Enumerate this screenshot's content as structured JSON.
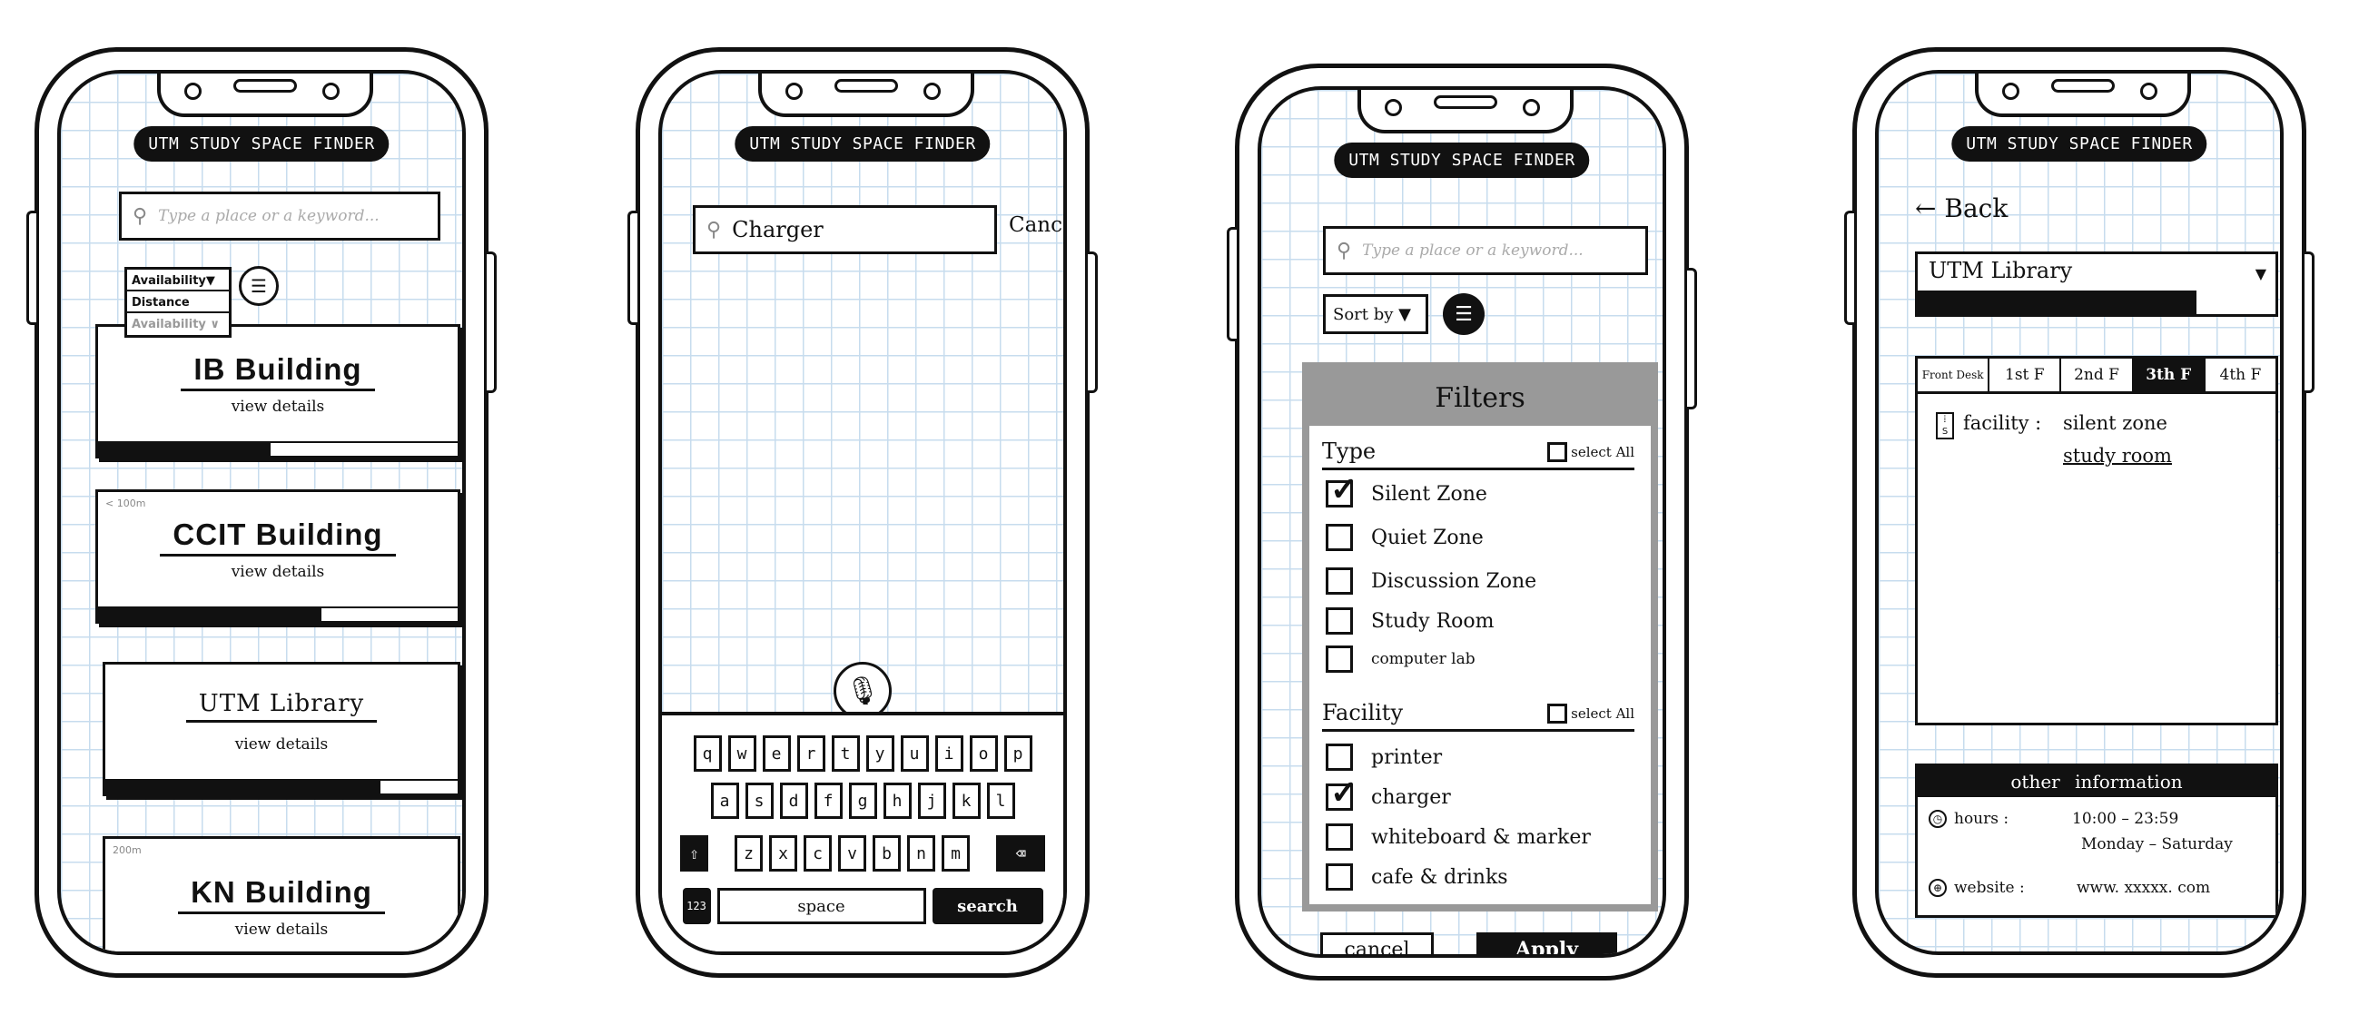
{
  "app_title": "UTM STUDY SPACE FINDER",
  "search": {
    "placeholder": "Type a place or a keyword..."
  },
  "home": {
    "sort_options": [
      "Availability▼",
      "Distance",
      "Availability ∨"
    ],
    "filter_icon": "sliders-icon",
    "buildings": [
      {
        "name": "IB Building",
        "details": "view details",
        "distance": "",
        "availability": 0.48
      },
      {
        "name": "CCIT Building",
        "details": "view details",
        "distance": "< 100m",
        "availability": 0.62
      },
      {
        "name": "UTM Library",
        "details": "view details",
        "distance": "",
        "availability": 0.78
      },
      {
        "name": "KN Building",
        "details": "view details",
        "distance": "200m",
        "availability": null
      }
    ]
  },
  "search_screen": {
    "query": "Charger",
    "cancel": "Cancel",
    "mic_icon": "microphone-icon",
    "keyboard": {
      "row1": [
        "q",
        "w",
        "e",
        "r",
        "t",
        "y",
        "u",
        "i",
        "o",
        "p"
      ],
      "row2": [
        "a",
        "s",
        "d",
        "f",
        "g",
        "h",
        "j",
        "k",
        "l"
      ],
      "row3": [
        "z",
        "x",
        "c",
        "v",
        "b",
        "n",
        "m"
      ],
      "numbers": "123",
      "space": "space",
      "search": "search"
    }
  },
  "filter_screen": {
    "sort_label": "Sort by ▼",
    "filters_title": "Filters",
    "type_title": "Type",
    "select_all": "select All",
    "type_options": [
      {
        "label": "Silent Zone",
        "checked": true
      },
      {
        "label": "Quiet Zone",
        "checked": false
      },
      {
        "label": "Discussion Zone",
        "checked": false
      },
      {
        "label": "Study Room",
        "checked": false
      },
      {
        "label": "computer lab",
        "checked": false
      }
    ],
    "facility_title": "Facility",
    "facility_select_all": "select All",
    "facility_options": [
      {
        "label": "printer",
        "checked": false
      },
      {
        "label": "charger",
        "checked": true
      },
      {
        "label": "whiteboard & marker",
        "checked": false
      },
      {
        "label": "cafe & drinks",
        "checked": false
      }
    ],
    "cancel": "cancel",
    "apply": "Apply"
  },
  "detail_screen": {
    "back": "← Back",
    "location": "UTM Library",
    "occupancy": 0.78,
    "floor_tabs": [
      "Front Desk",
      "1st F",
      "2nd F",
      "3th F",
      "4th F"
    ],
    "active_floor": "3th F",
    "facility_label": "facility :",
    "facility_values": [
      "silent zone",
      "study room"
    ],
    "other_info_title": "other information",
    "hours_label": "hours :",
    "hours_time": "10:00 – 23:59",
    "hours_days": "Monday – Saturday",
    "website_label": "website :",
    "website_value": "www. xxxxx. com"
  },
  "colors": {
    "ink": "#111111",
    "panel_gray": "#999999",
    "grid": "#c7dcee"
  }
}
